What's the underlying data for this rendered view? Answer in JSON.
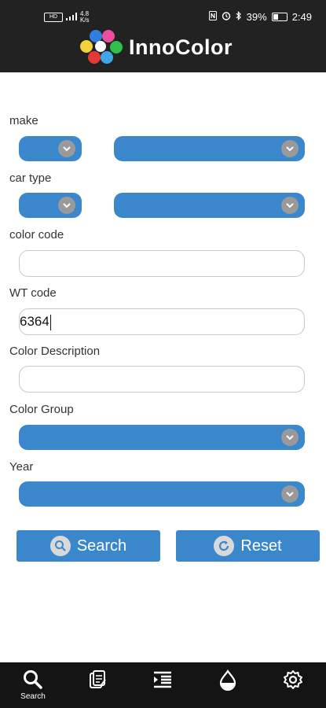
{
  "status_bar": {
    "speed": "4.8",
    "speed_unit": "K/s",
    "network": "HD",
    "battery": "39%",
    "time": "2:49"
  },
  "brand": {
    "name": "InnoColor"
  },
  "form": {
    "make_label": "make",
    "car_type_label": "car type",
    "color_code_label": "color code",
    "color_code_value": "",
    "wt_code_label": "WT code",
    "wt_code_value": "6364",
    "color_description_label": "Color Description",
    "color_description_value": "",
    "color_group_label": "Color Group",
    "year_label": "Year"
  },
  "buttons": {
    "search": "Search",
    "reset": "Reset"
  },
  "bottom_nav": {
    "items": [
      {
        "icon": "search-icon",
        "label": "Search"
      },
      {
        "icon": "formula-icon",
        "label": ""
      },
      {
        "icon": "list-indent-icon",
        "label": ""
      },
      {
        "icon": "drop-icon",
        "label": ""
      },
      {
        "icon": "gear-icon",
        "label": ""
      }
    ]
  },
  "colors": {
    "accent": "#3b87cc",
    "header": "#222222",
    "navbar": "#141414"
  }
}
